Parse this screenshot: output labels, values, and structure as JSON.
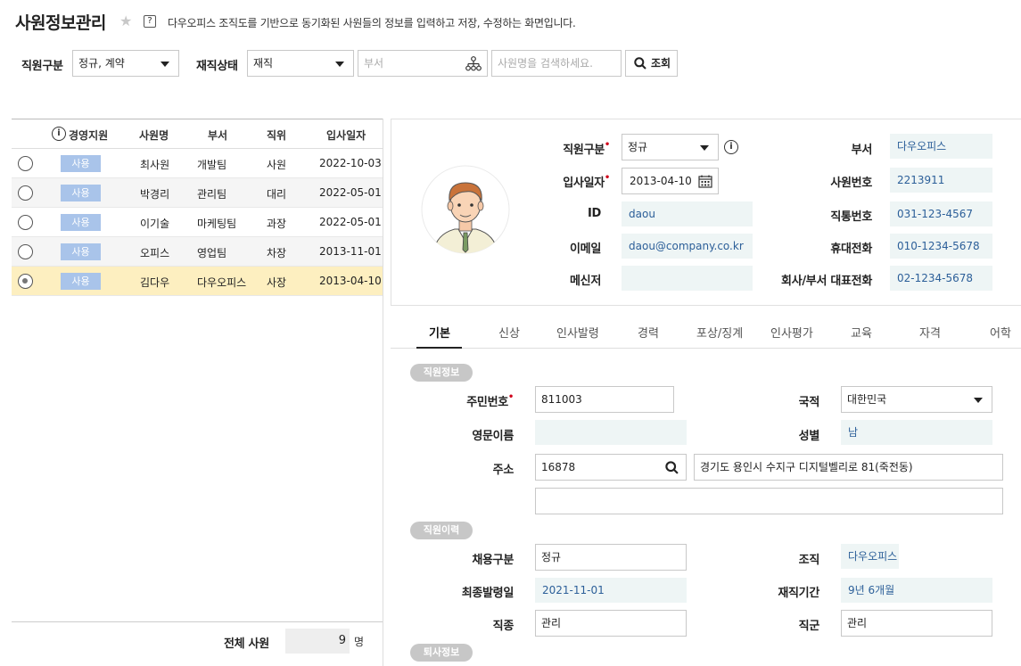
{
  "header": {
    "title": "사원정보관리",
    "help": "?",
    "description": "다우오피스 조직도를 기반으로 동기화된 사원들의 정보를 입력하고 저장, 수정하는 화면입니다."
  },
  "filters": {
    "type_label": "직원구분",
    "type_value": "정규, 계약",
    "status_label": "재직상태",
    "status_value": "재직",
    "dept_placeholder": "부서",
    "name_placeholder": "사원명을 검색하세요.",
    "search_button": "조회"
  },
  "table": {
    "headers": [
      "경영지원",
      "사원명",
      "부서",
      "직위",
      "입사일자"
    ],
    "info_glyph": "i",
    "rows": [
      {
        "status": "사용",
        "name": "최사원",
        "dept": "개발팀",
        "position": "사원",
        "date": "2022-10-03",
        "selected": false
      },
      {
        "status": "사용",
        "name": "박경리",
        "dept": "관리팀",
        "position": "대리",
        "date": "2022-05-01",
        "selected": false
      },
      {
        "status": "사용",
        "name": "이기술",
        "dept": "마케팅팀",
        "position": "과장",
        "date": "2022-05-01",
        "selected": false
      },
      {
        "status": "사용",
        "name": "오피스",
        "dept": "영업팀",
        "position": "차장",
        "date": "2013-11-01",
        "selected": false
      },
      {
        "status": "사용",
        "name": "김다우",
        "dept": "다우오피스",
        "position": "사장",
        "date": "2013-04-10",
        "selected": true
      }
    ],
    "total_label": "전체 사원",
    "total_value": "9",
    "total_unit": "명"
  },
  "profile": {
    "type_label": "직원구분",
    "type_value": "정규",
    "hire_label": "입사일자",
    "hire_value": "2013-04-10",
    "id_label": "ID",
    "id_value": "daou",
    "email_label": "이메일",
    "email_value": "daou@company.co.kr",
    "messenger_label": "메신저",
    "messenger_value": "",
    "dept_label": "부서",
    "dept_value": "다우오피스",
    "empno_label": "사원번호",
    "empno_value": "2213911",
    "direct_label": "직통번호",
    "direct_value": "031-123-4567",
    "mobile_label": "휴대전화",
    "mobile_value": "010-1234-5678",
    "main_label": "회사/부서 대표전화",
    "main_value": "02-1234-5678",
    "info_glyph": "i",
    "required_mark": "•"
  },
  "tabs": [
    "기본",
    "신상",
    "인사발령",
    "경력",
    "포상/징계",
    "인사평가",
    "교육",
    "자격",
    "어학"
  ],
  "basic": {
    "section1": "직원정보",
    "ssn_label": "주민번호",
    "ssn_value": "811003",
    "nation_label": "국적",
    "nation_value": "대한민국",
    "eng_label": "영문이름",
    "eng_value": "",
    "gender_label": "성별",
    "gender_value": "남",
    "addr_label": "주소",
    "zip_value": "16878",
    "addr_value": "경기도 용인시 수지구 디지털벨리로 81(죽전동)",
    "addr2_value": "",
    "section2": "직원이력",
    "hiretype_label": "채용구분",
    "hiretype_value": "정규",
    "org_label": "조직",
    "org_value": "다우오피스",
    "lastorder_label": "최종발령일",
    "lastorder_value": "2021-11-01",
    "tenure_label": "재직기간",
    "tenure_value": "9년 6개월",
    "job_label": "직종",
    "job_value": "관리",
    "jobgroup_label": "직군",
    "jobgroup_value": "관리",
    "section3": "퇴사정보"
  },
  "colors": {
    "accent_badge": "#a9c4ea",
    "selected_row": "#fdefc0",
    "readonly_bg": "#eef5f5",
    "value_blue": "#2c5f99",
    "required_red": "#d0021b"
  }
}
